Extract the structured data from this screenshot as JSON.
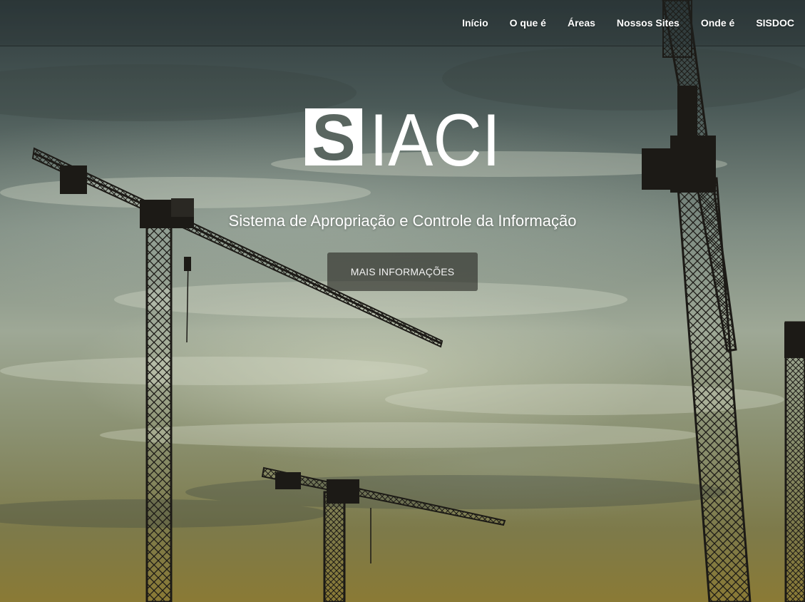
{
  "nav": {
    "items": [
      {
        "label": "Início"
      },
      {
        "label": "O que é"
      },
      {
        "label": "Áreas"
      },
      {
        "label": "Nossos Sites"
      },
      {
        "label": "Onde é"
      },
      {
        "label": "SISDOC"
      }
    ]
  },
  "hero": {
    "logo_text": "SIACI",
    "logo_letters": [
      "S",
      "IACI"
    ],
    "tagline": "Sistema de Apropriação e Controle da Informação",
    "cta_label": "MAIS INFORMAÇÕES",
    "background_image": "construction-cranes-at-dusk"
  },
  "colors": {
    "text": "#ffffff",
    "button_bg": "#2a2a25",
    "sky_top": "#2f3b3d",
    "sky_horizon": "#8a7a35",
    "crane": "#1c1a16"
  }
}
